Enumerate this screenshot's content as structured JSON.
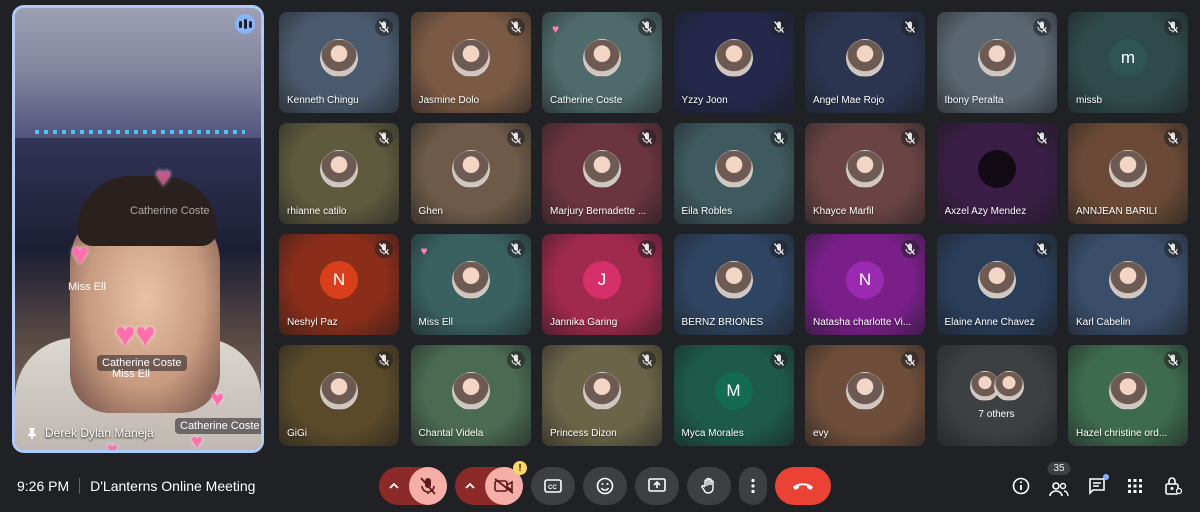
{
  "meeting": {
    "time": "9:26 PM",
    "title": "D'Lanterns Online Meeting",
    "participant_count": "35"
  },
  "speaker": {
    "name": "Derek Dylan Maneja",
    "overlays": [
      "Catherine Coste",
      "Miss Ell",
      "Catherine Coste",
      "Miss Ell",
      "Catherine Coste"
    ]
  },
  "tiles": [
    {
      "name": "Kenneth Chingu",
      "bg": "#4a5a6e",
      "avatar": "photo"
    },
    {
      "name": "Jasmine Dolo",
      "bg": "#7a5a44",
      "avatar": "photo"
    },
    {
      "name": "Catherine Coste",
      "bg": "#4e6a6a",
      "avatar": "photo",
      "reaction": "heart"
    },
    {
      "name": "Yzzy Joon",
      "bg": "#25284a",
      "avatar": "photo"
    },
    {
      "name": "Angel Mae Rojo",
      "bg": "#2b3550",
      "avatar": "photo"
    },
    {
      "name": "Ibony Peralta",
      "bg": "#5a6670",
      "avatar": "photo"
    },
    {
      "name": "missb",
      "bg": "#2f4a4a",
      "avatar": "letter",
      "letter": "m",
      "avatar_color": "#2e5454"
    },
    {
      "name": "rhianne catilo",
      "bg": "#5e5a3e",
      "avatar": "photo"
    },
    {
      "name": "Ghen",
      "bg": "#6e5a48",
      "avatar": "photo"
    },
    {
      "name": "Marjury Bernadette ...",
      "bg": "#6a3440",
      "avatar": "photo"
    },
    {
      "name": "Eila Robles",
      "bg": "#3e5a5e",
      "avatar": "photo"
    },
    {
      "name": "Khayce Marfil",
      "bg": "#6a4444",
      "avatar": "photo"
    },
    {
      "name": "Axzel Azy Mendez",
      "bg": "#3a1e46",
      "avatar": "dark"
    },
    {
      "name": "ANNJEAN BARILI",
      "bg": "#6a4a36",
      "avatar": "photo"
    },
    {
      "name": "Neshyl Paz",
      "bg": "#8a2e1a",
      "avatar": "letter",
      "letter": "N",
      "avatar_color": "#d93f1a"
    },
    {
      "name": "Miss Ell",
      "bg": "#3a6060",
      "avatar": "photo",
      "reaction": "heart"
    },
    {
      "name": "Jannika Garing",
      "bg": "#a0294e",
      "avatar": "letter",
      "letter": "J",
      "avatar_color": "#d6306a"
    },
    {
      "name": "BERNZ BRIONES",
      "bg": "#2e4460",
      "avatar": "photo"
    },
    {
      "name": "Natasha charlotte Vi...",
      "bg": "#7a1f8a",
      "avatar": "letter",
      "letter": "N",
      "avatar_color": "#9a2ab0"
    },
    {
      "name": "Elaine Anne Chavez",
      "bg": "#2a3e5a",
      "avatar": "photo"
    },
    {
      "name": "Karl Cabelin",
      "bg": "#3a4e6a",
      "avatar": "photo"
    },
    {
      "name": "GiGi",
      "bg": "#5a4a2a",
      "avatar": "photo"
    },
    {
      "name": "Chantal Videla",
      "bg": "#4a6a52",
      "avatar": "photo"
    },
    {
      "name": "Princess Dizon",
      "bg": "#6a6448",
      "avatar": "photo"
    },
    {
      "name": "Myca Morales",
      "bg": "#1e5a4a",
      "avatar": "letter",
      "letter": "M",
      "avatar_color": "#136b52"
    },
    {
      "name": "evy",
      "bg": "#6e4e3a",
      "avatar": "photo"
    },
    {
      "name": "7 others",
      "bg": "#3c4043",
      "avatar": "others"
    },
    {
      "name": "Hazel christine ord...",
      "bg": "#3e6a4e",
      "avatar": "photo"
    }
  ],
  "colors": {
    "accent": "#8ab4f8",
    "end_call": "#ea4335",
    "muted_bg": "#8c2a2a",
    "muted_btn": "#f6aea9"
  }
}
